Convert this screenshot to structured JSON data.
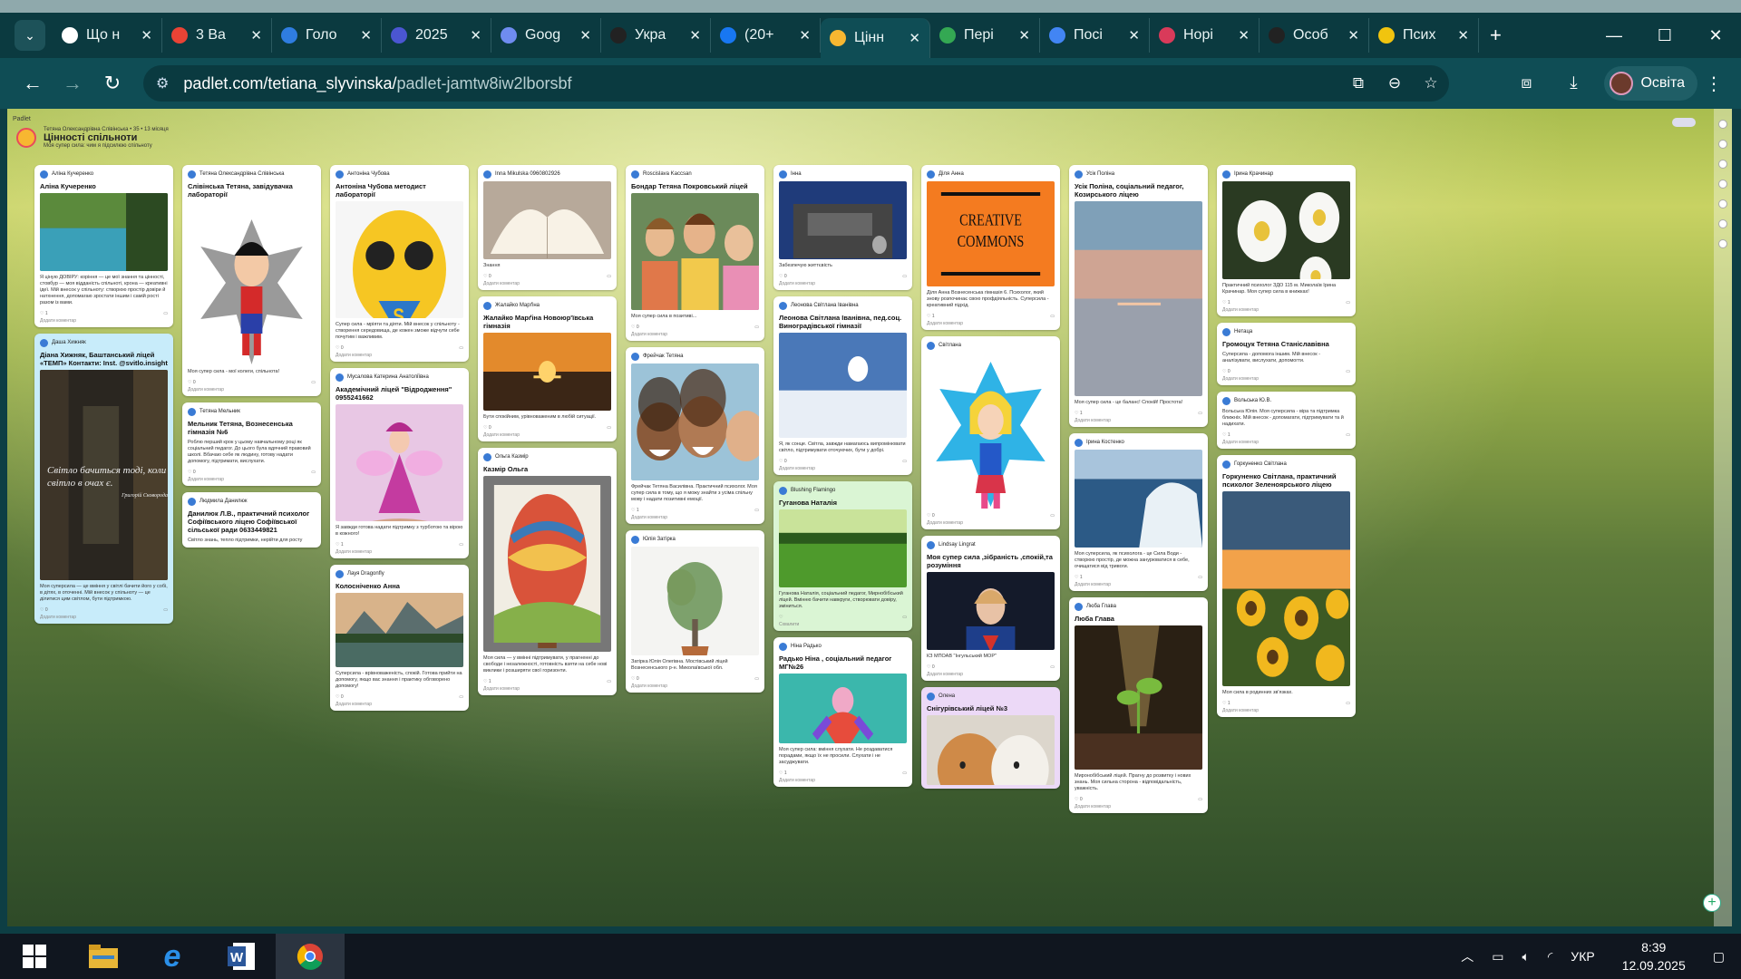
{
  "browser": {
    "tabs": [
      {
        "title": "Що н",
        "icon": "github-icon",
        "color": "#ffffff"
      },
      {
        "title": "3 Ва",
        "icon": "gmail-icon",
        "color": "#ea4335"
      },
      {
        "title": "Голо",
        "icon": "voice-icon",
        "color": "#2f7de1"
      },
      {
        "title": "2025",
        "icon": "calendar-icon",
        "color": "#4b56d2"
      },
      {
        "title": "Goog",
        "icon": "gemini-icon",
        "color": "#6f8cf0"
      },
      {
        "title": "Укра",
        "icon": "openai-icon",
        "color": "#222222"
      },
      {
        "title": "(20+",
        "icon": "facebook-icon",
        "color": "#1877f2"
      },
      {
        "title": "Цінн",
        "icon": "padlet-icon",
        "color": "#f7b731",
        "active": true
      },
      {
        "title": "Пері",
        "icon": "drive-icon",
        "color": "#34a853"
      },
      {
        "title": "Посі",
        "icon": "docs-icon",
        "color": "#4285f4"
      },
      {
        "title": "Норі",
        "icon": "psi-icon",
        "color": "#d93a5a"
      },
      {
        "title": "Особ",
        "icon": "m-icon",
        "color": "#222222"
      },
      {
        "title": "Псих",
        "icon": "circle-icon",
        "color": "#f1c40f"
      }
    ],
    "url_main": "padlet.com/tetiana_slyvinska/",
    "url_rest": "padlet-jamtw8iw2lborsbf",
    "profile": "Освіта"
  },
  "padlet": {
    "breadcrumb": "Padlet",
    "author": "Тетяна Олександрівна Слівінська • 35 • 13 місяця",
    "title": "Цінності спільноти",
    "subtitle": "Моя супер сила: чим я підсилюю спільноту",
    "columns": [
      [
        {
          "author": "Аліна Кучеренко",
          "title": "Аліна Кучеренко",
          "img": "lake",
          "h": 100,
          "body": "Я ціную ДОВІРУ: коріння — це мої знання та цінності, стовбур — моя відданість спільноті, крона — креативні ідеї. Мій внесок у спільноту: створюю простір довіри й натхнення, допомагаю зростати іншим і самій рості разом із вами.",
          "likes": "1",
          "comments": "Додати коментар"
        },
        {
          "author": "Даша Хижняк",
          "title": "Діана Хижняк, Баштанський ліцей «ТЕМП» Контакти: Inst. @svitlo.insight",
          "img": "curtain",
          "h": 270,
          "theme": "blue",
          "quote": "Світло бачиться тоді, коли світло в очах є.",
          "quote_author": "Григорій Сковорода",
          "body": "Моя суперсила — це вміння у світлі бачити його у собі, в дітях, в оточенні. Мій внесок у спільноту — це ділитися цим світлом, бути підтримкою.",
          "likes": "0",
          "comments": "Додати коментар"
        }
      ],
      [
        {
          "author": "Тетяна Олександрівна Слівінська",
          "title": "Слівінська Тетяна, завідувачка лабораторії",
          "img": "wonder",
          "h": 210,
          "body": "Моя супер сила - мої колеги, спільнота!",
          "likes": "0",
          "comments": "Додати коментар"
        },
        {
          "author": "Тетяна Мельник",
          "title": "Мельник Тетяна, Вознесенська гімназія №6",
          "img": "hands",
          "h": 100,
          "body": "Роблю перший крок у цьому навчальному році як соціальний педагог. До цього була вдячний правовий школі. Вбачаю себе як людину, готову надати допомогу, підтримати, вислухати.",
          "likes": "0",
          "comments": "Додати коментар"
        },
        {
          "author": "Людмила Данилюк",
          "title": "Данилюк Л.В., практичний психолог Софіївського ліцею Софіївської сільської ради 0633449821",
          "img": "none",
          "h": 0,
          "body": "Світло знань, тепло підтримки, нерійти для росту",
          "likes": "",
          "comments": ""
        }
      ],
      [
        {
          "author": "Антоніна Чубова",
          "title": "Антоніна Чубова методист лабораторії",
          "img": "emoji",
          "h": 150,
          "body": "Супер сила - мріяти та діяти. Мій внесок у спільноту - створення середовища, де кожен зможе відчути себе почутим і важливим.",
          "likes": "0",
          "comments": "Додати коментар"
        },
        {
          "author": "Мусалова Катерина Анатоліївна",
          "title": "Академічний ліцей \"Відродження\" 0955241662",
          "img": "fairy",
          "h": 150,
          "body": "Я завжди готова надати підтримку з турботою та вірою в кожного!",
          "likes": "1",
          "comments": "Додати коментар"
        },
        {
          "author": "Лауя Dragonfly",
          "title": "Колосніченко Анна",
          "img": "mountain",
          "h": 95,
          "body": "Суперсила - врівноваженість, спокій. Готова прийти на допомогу, якщо вас знання і практику обговорено допомогу!",
          "likes": "0",
          "comments": "Додати коментар"
        }
      ],
      [
        {
          "author": "Inna Mikulska 0960802926",
          "title": "",
          "img": "book",
          "h": 100,
          "body": "Знання",
          "likes": "0",
          "comments": "Додати коментар"
        },
        {
          "author": "Жалайко Марґіна",
          "title": "Жалайко Марґіна Новоюр'ївська гімназія",
          "img": "sunset",
          "h": 100,
          "body": "Бути спокійним, урівноваженим в любій ситуації.",
          "likes": "0",
          "comments": "Додати коментар"
        },
        {
          "author": "Ольга Казмір",
          "title": "Казмір Ольга",
          "img": "balloon",
          "h": 225,
          "body": "Моя сила — у вмінні підтримувати, у прагненні до свободи і незалежності, готовність взяти на себе нові виклики і розширяти свої горизонти.",
          "likes": "1",
          "comments": "Додати коментар"
        }
      ],
      [
        {
          "author": "Roscislava Kaccsan",
          "title": "Бондар Тетяна Покровський ліцей",
          "img": "girls",
          "h": 150,
          "body": "Моя супер сила в позитиві...",
          "likes": "0",
          "comments": "Додати коментар"
        },
        {
          "author": "Фрейчак Тетяна",
          "title": "",
          "img": "kids",
          "h": 150,
          "body": "Фрейчак Тетяна Василівна. Практичний психолог. Моя супер сила в тому, що я можу знайти з усіма спільну мову і надати позитивні емоції.",
          "likes": "1",
          "comments": "Додати коментар"
        },
        {
          "author": "Юлія Затірка",
          "title": "",
          "img": "tree",
          "h": 140,
          "body": "Затірка Юлія Олегівна. Мостівський ліцей Вознесенського р-н. Миколаївської обл.",
          "likes": "0",
          "comments": "Додати коментар"
        }
      ],
      [
        {
          "author": "Інна",
          "title": "",
          "img": "engine",
          "h": 100,
          "body": "Забезпечую життєвість",
          "likes": "0",
          "comments": "Додати коментар"
        },
        {
          "author": "Леонова Світлана Іванівна",
          "title": "Леонова Світлана Іванівна, пед.соц. Виноградівської гімназії",
          "img": "snow",
          "h": 135,
          "body": "Я, як сонце. Світла, завжди намагаюсь випромінювати світло, підтримувати оточуючих, бути у добрі.",
          "likes": "0",
          "comments": "Додати коментар"
        },
        {
          "author": "Blushing Flamingo",
          "title": "Гуганова Наталія",
          "img": "meadow",
          "h": 100,
          "theme": "green",
          "body": "Гуганова Наталія, соціальний педагог, Мирнобібський ліцей. Вмінню бачити навкруги, створювати довіру, зміниться.",
          "likes": "",
          "comments": "Схвалити"
        },
        {
          "author": "Ніна Радько",
          "title": "Радько Ніна , соціальний педагог МГ№26",
          "img": "heart",
          "h": 90,
          "body": "Моя супер сила: вміння слухати. Не роздаватися порадами, якщо їх не просили. Слухати і не засуджувати.",
          "likes": "1",
          "comments": "Додати коментар"
        }
      ],
      [
        {
          "author": "Діля Анна",
          "title": "",
          "img": "cc",
          "h": 135,
          "body": "Діля Анна Вознесенська гімназія 6. Психолог, який знову розпочинає свою профдіяльність. Суперсила - креативний підхід.",
          "likes": "1",
          "comments": "Додати коментар"
        },
        {
          "author": "Світлана",
          "title": "",
          "img": "supergirl",
          "h": 200,
          "body": "",
          "likes": "0",
          "comments": "Додати коментар"
        },
        {
          "author": "Lindsay Lingrat",
          "title": "Моя супер сила ,зібраність ,спокій,та розуміння",
          "img": "superman",
          "h": 100,
          "body": "КЗ МПОАВ \"Інгульський МОР\"",
          "likes": "0",
          "comments": "Додати коментар"
        },
        {
          "author": "Олена",
          "title": "Снігурівський ліцей №3",
          "img": "fox",
          "h": 90,
          "theme": "purple",
          "body": "",
          "likes": "",
          "comments": ""
        }
      ],
      [
        {
          "author": "Усік Поліна",
          "title": "Усік Поліна, соціальний педагог, Козирського ліцею",
          "img": "sky",
          "h": 250,
          "body": "Моя супер сила - це баланс! Спокій! Простота!",
          "likes": "1",
          "comments": "Додати коментар"
        },
        {
          "author": "Ірина Костенко",
          "title": "",
          "img": "wave",
          "h": 125,
          "body": "Моя суперсила, як психолога - це Сила Води - створюю простір, де можна занурюватися в себе, очищатися від тривоги.",
          "likes": "1",
          "comments": "Додати коментар"
        },
        {
          "author": "Люба Глава",
          "title": "Люба Глава",
          "img": "sprout",
          "h": 185,
          "body": "Миронобібський ліцей. Прагну до розвитку і нових знань. Моя сильна сторона - відповідальність, уважність.",
          "likes": "0",
          "comments": "Додати коментар"
        }
      ],
      [
        {
          "author": "Ірина Крачинар",
          "title": "",
          "img": "daisies",
          "h": 125,
          "body": "Практичний психолог ЗДО 115 м. Миколаїв Ірина Крачинар. Моя супер сила в книжках!",
          "likes": "1",
          "comments": "Додати коментар"
        },
        {
          "author": "Нетаца",
          "title": "Громоцук Тетяна Станіславівна",
          "img": "none",
          "h": 0,
          "body": "Суперсила - допомога іншим. Мій внесок - аналізувати, вислухати, допомогти.",
          "likes": "0",
          "comments": "Додати коментар"
        },
        {
          "author": "Вольська Ю.В.",
          "title": "",
          "img": "none",
          "h": 0,
          "body": "Вольська Юлія. Моя суперсила - віра та підтримка ближніх. Мій внесок - допомагати, підтримувати та й надихати.",
          "likes": "1",
          "comments": "Додати коментар"
        },
        {
          "author": "Горкуненко Світлана",
          "title": "Горкуненко Світлана, практичний психолог Зеленоярського ліцею",
          "img": "sunflowers",
          "h": 250,
          "body": "Моя сила в родинних зв'язках.",
          "likes": "1",
          "comments": "Додати коментар"
        }
      ]
    ]
  },
  "taskbar": {
    "lang": "УКР",
    "time": "8:39",
    "date": "12.09.2025"
  }
}
